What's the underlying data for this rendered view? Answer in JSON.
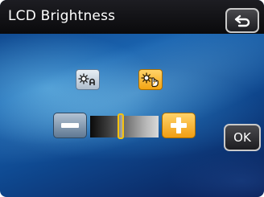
{
  "header": {
    "title": "LCD Brightness"
  },
  "buttons": {
    "ok_label": "OK"
  },
  "icons": {
    "back": "return-arrow-icon",
    "auto": "sun-auto-icon",
    "manual": "sun-hand-icon",
    "minus": "minus-icon",
    "plus": "plus-icon"
  },
  "brightness": {
    "mode": "manual",
    "level": 0.45
  },
  "colors": {
    "accent": "#f5b32a",
    "inactive": "#8ea3b8",
    "background": "#1a5aa8"
  }
}
